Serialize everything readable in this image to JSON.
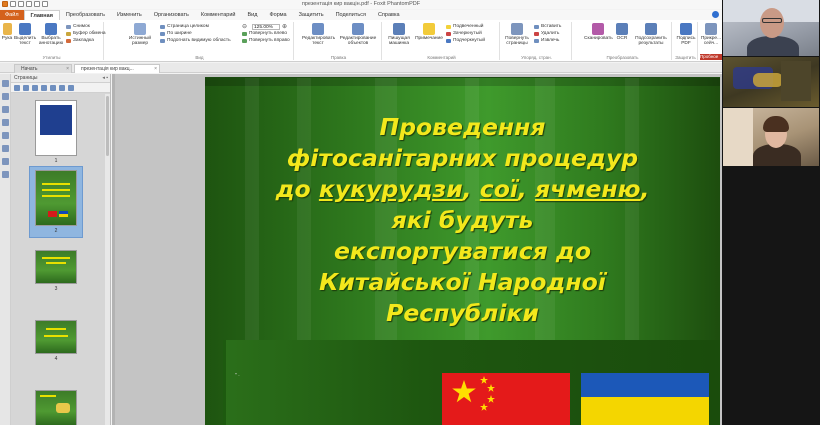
{
  "window": {
    "title": "презентація кир вакцін.pdf - Foxit PhantomPDF"
  },
  "menu": {
    "file": "Файл",
    "items": [
      "Главная",
      "Преобразовать",
      "Изменить",
      "Организовать",
      "Комментарий",
      "Вид",
      "Форма",
      "Защитить",
      "Поделиться",
      "Справка"
    ],
    "active": "Главная"
  },
  "ribbon": {
    "tools": {
      "hand": "Рука",
      "select_text": "Выделить текст",
      "select_annot": "Выбрать аннотацию",
      "snapshot": "Снимок",
      "clipboard": "Буфер обмена",
      "bookmark": "Закладка",
      "group": "Утилиты"
    },
    "view": {
      "actual_size": "Истинный размер",
      "fit_page": "Страница целиком",
      "fit_width": "По ширине",
      "fit_visible": "Подогнать видимую область",
      "zoom": "125.00%",
      "rotate_left": "Повернуть влево",
      "rotate_right": "Повернуть вправо",
      "group": "Вид"
    },
    "edit": {
      "edit_text": "Редактировать текст",
      "edit_object": "Редактирование объектов",
      "group": "Правка"
    },
    "comment": {
      "typewriter": "Пишущая машинка",
      "note": "Примечание",
      "highlight": "Подвеченный",
      "strikeout": "Зачеркнутый",
      "underline": "Подчеркнутый",
      "group": "Комментарий"
    },
    "pages": {
      "rotate": "Повернуть страницы",
      "insert": "Вставить",
      "delete": "Удалить",
      "extract": "Извлечь",
      "group": "Упоряд. стран."
    },
    "convert": {
      "scan": "Сканировать",
      "ocr": "OCR",
      "searchable": "Подсохранить результаты",
      "group": "Преобразовать"
    },
    "protect": {
      "sign": "Подпись PDF",
      "group": "Защитить"
    },
    "share": {
      "attach": "Прикре... сейч...",
      "trial": "Пробное"
    }
  },
  "tabs": [
    {
      "label": "Начать",
      "close": "×"
    },
    {
      "label": "презентація кир вакц...",
      "close": "×"
    }
  ],
  "pages_panel": {
    "title": "Страницы",
    "thumbs": [
      {
        "num": "1",
        "selected": false
      },
      {
        "num": "2",
        "selected": true
      },
      {
        "num": "3",
        "selected": false
      },
      {
        "num": "4",
        "selected": false
      }
    ]
  },
  "slide": {
    "lines": [
      [
        "Проведення"
      ],
      [
        "фітосанітарних процедур"
      ],
      [
        "до ",
        "кукурудзи",
        ", ",
        "сої",
        ", ",
        "ячменю",
        ","
      ],
      [
        "які будуть"
      ],
      [
        "експортуватися до"
      ],
      [
        "Китайської Народної"
      ],
      [
        "Республіки"
      ]
    ],
    "dots": "\" ·"
  },
  "colors": {
    "file_tab": "#d4611c",
    "slide_green": "#3f9a2c",
    "title_yellow": "#f3e81c",
    "china_red": "#e41a1a",
    "ukraine_blue": "#1c58b8",
    "ukraine_yellow": "#f4d600"
  }
}
